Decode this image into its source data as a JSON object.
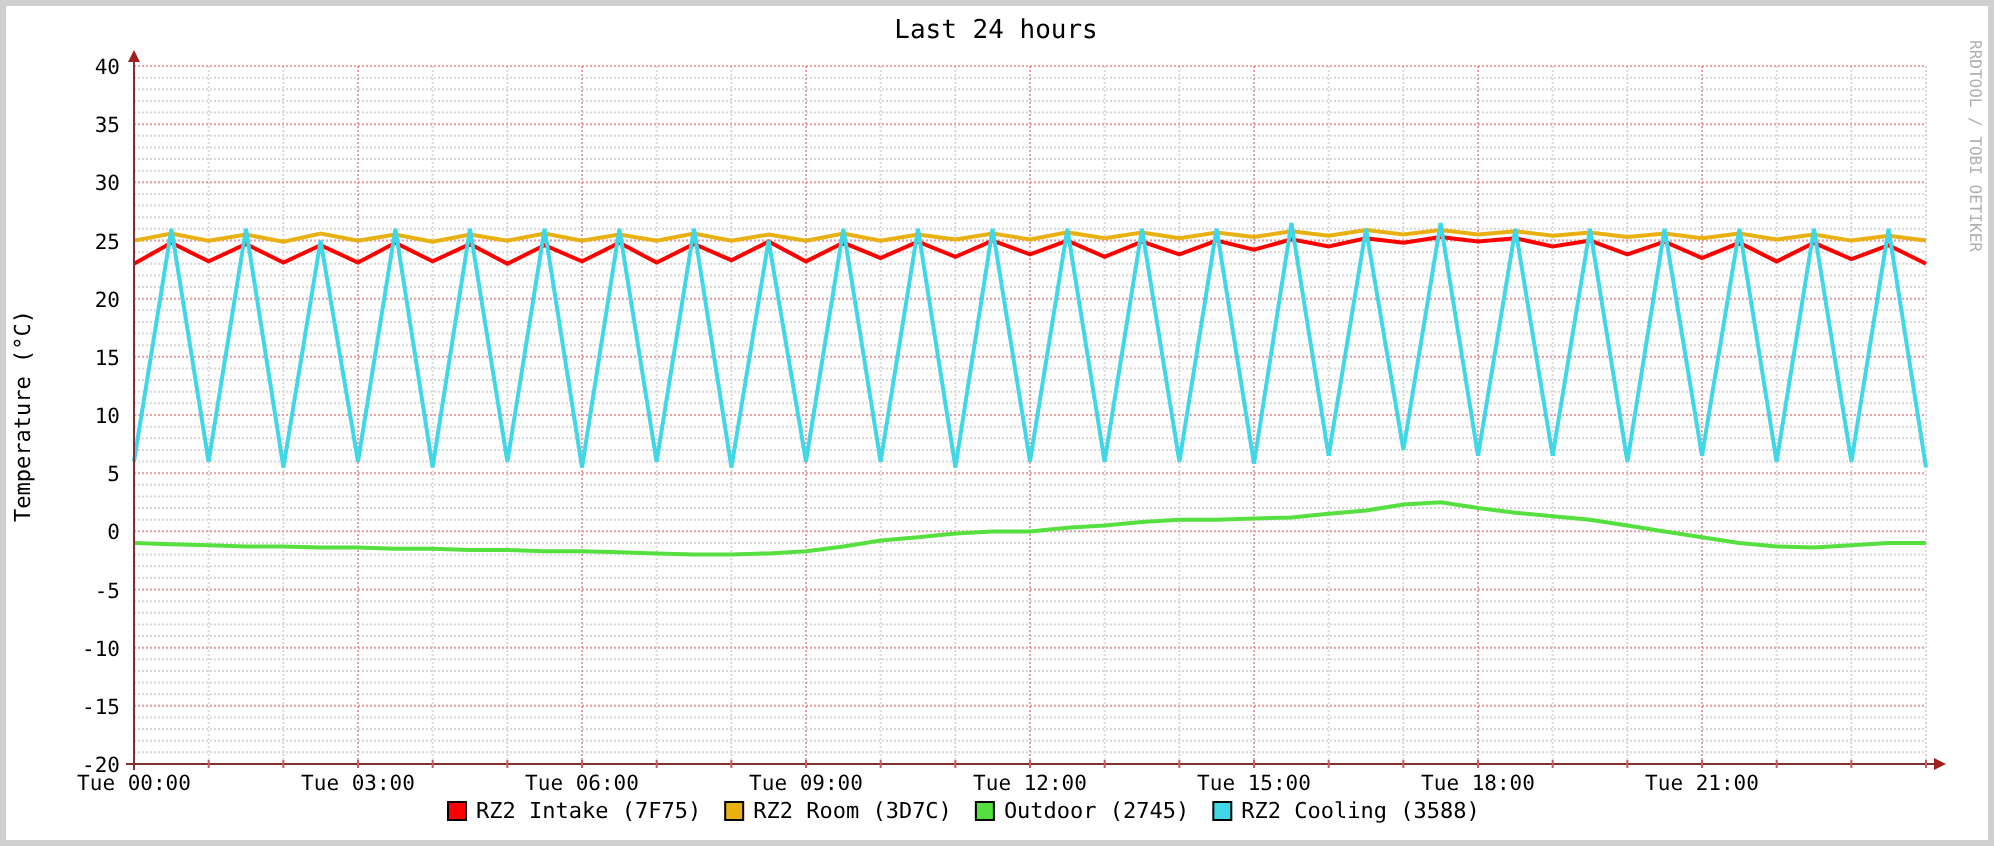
{
  "graph": {
    "credit": "RRDTOOL / TOBI OETIKER",
    "chart_data": {
      "type": "line",
      "title": "Last 24 hours",
      "ylabel": "Temperature (°C)",
      "categories": [
        "Tue 00:00",
        null,
        null,
        null,
        null,
        null,
        "Tue 03:00",
        null,
        null,
        null,
        null,
        null,
        "Tue 06:00",
        null,
        null,
        null,
        null,
        null,
        "Tue 09:00",
        null,
        null,
        null,
        null,
        null,
        "Tue 12:00",
        null,
        null,
        null,
        null,
        null,
        "Tue 15:00",
        null,
        null,
        null,
        null,
        null,
        "Tue 18:00",
        null,
        null,
        null,
        null,
        null,
        "Tue 21:00",
        null,
        null,
        null,
        null,
        null,
        null
      ],
      "series": [
        {
          "name": "RZ2 Intake (7F75)",
          "color": "#ff0000",
          "values": [
            23,
            24.8,
            23.2,
            24.7,
            23.1,
            24.6,
            23.1,
            24.8,
            23.2,
            24.7,
            23,
            24.6,
            23.2,
            24.8,
            23.1,
            24.7,
            23.3,
            24.9,
            23.2,
            24.8,
            23.5,
            24.9,
            23.6,
            25,
            23.8,
            25,
            23.6,
            24.9,
            23.8,
            25,
            24.2,
            25.1,
            24.5,
            25.2,
            24.8,
            25.3,
            24.9,
            25.2,
            24.5,
            25,
            23.8,
            24.9,
            23.5,
            24.8,
            23.2,
            24.8,
            23.4,
            24.6,
            23
          ]
        },
        {
          "name": "RZ2 Room (3D7C)",
          "color": "#e8b010",
          "values": [
            25,
            25.6,
            25,
            25.5,
            24.9,
            25.6,
            25,
            25.5,
            24.9,
            25.5,
            25,
            25.6,
            25,
            25.5,
            25,
            25.6,
            25,
            25.5,
            25,
            25.6,
            25,
            25.5,
            25.1,
            25.6,
            25.1,
            25.7,
            25.2,
            25.7,
            25.2,
            25.7,
            25.3,
            25.8,
            25.4,
            25.9,
            25.5,
            25.9,
            25.5,
            25.8,
            25.4,
            25.7,
            25.3,
            25.6,
            25.2,
            25.6,
            25.1,
            25.5,
            25,
            25.4,
            25
          ]
        },
        {
          "name": "Outdoor (2745)",
          "color": "#55e040",
          "values": [
            -1,
            -1.1,
            -1.2,
            -1.3,
            -1.3,
            -1.4,
            -1.4,
            -1.5,
            -1.5,
            -1.6,
            -1.6,
            -1.7,
            -1.7,
            -1.8,
            -1.9,
            -2,
            -2,
            -1.9,
            -1.7,
            -1.3,
            -0.8,
            -0.5,
            -0.2,
            0,
            0,
            0.3,
            0.5,
            0.8,
            1,
            1,
            1.1,
            1.2,
            1.5,
            1.8,
            2.3,
            2.5,
            2,
            1.6,
            1.3,
            1,
            0.5,
            0,
            -0.5,
            -1,
            -1.3,
            -1.4,
            -1.2,
            -1,
            -1
          ]
        },
        {
          "name": "RZ2 Cooling (3588)",
          "color": "#40d8e8",
          "values": [
            6,
            26,
            6,
            26,
            5.5,
            25,
            6,
            26,
            5.5,
            26,
            6,
            26,
            5.5,
            26,
            6,
            26,
            5.5,
            25,
            6,
            26,
            6,
            26,
            5.5,
            26,
            6,
            26,
            6,
            26,
            6,
            26,
            5.8,
            26.5,
            6.5,
            26,
            7,
            26.5,
            6.5,
            26,
            6.5,
            26,
            6,
            26,
            6.5,
            26,
            6,
            26,
            6,
            26,
            5.5
          ]
        }
      ],
      "grid": true,
      "legend": "bottom",
      "ylim": [
        -20,
        40
      ],
      "yticks": [
        -20,
        -15,
        -10,
        -5,
        0,
        5,
        10,
        15,
        20,
        25,
        30,
        35,
        40
      ]
    }
  }
}
